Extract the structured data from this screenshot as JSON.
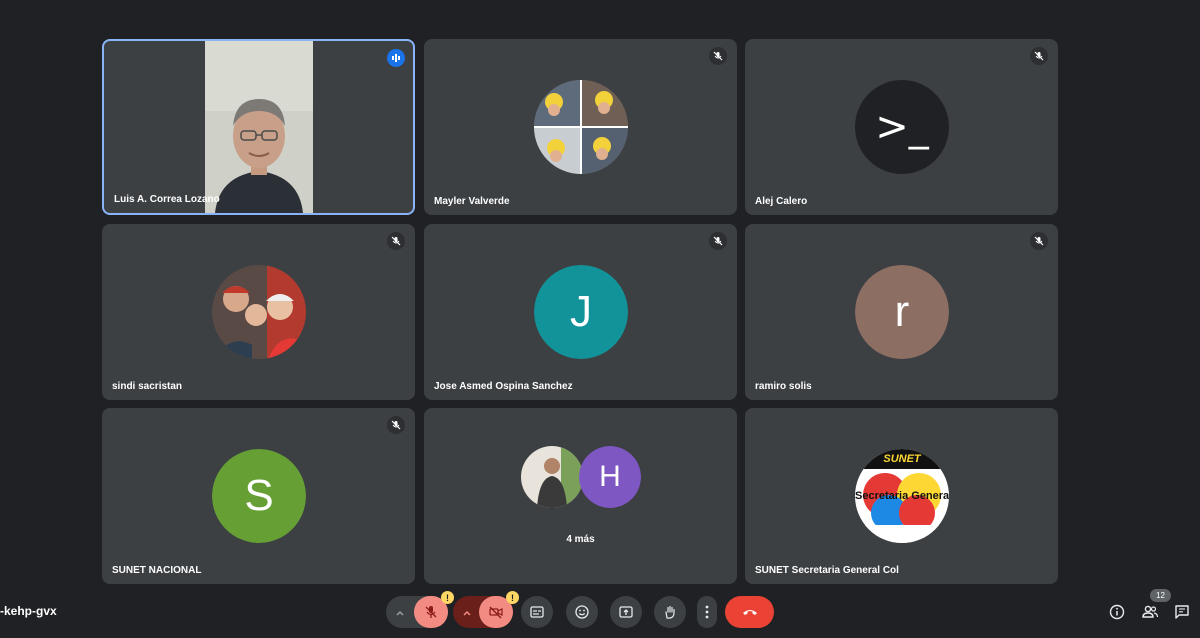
{
  "meeting": {
    "code": "-kehp-gvx",
    "participant_count": "12"
  },
  "tiles": [
    {
      "name": "Luis A. Correa Lozano",
      "state": "speaking"
    },
    {
      "name": "Mayler Valverde",
      "state": "muted"
    },
    {
      "name": "Alej Calero",
      "state": "muted",
      "avatar_text": ">_"
    },
    {
      "name": "sindi sacristan",
      "state": "muted"
    },
    {
      "name": "Jose Asmed Ospina Sanchez",
      "state": "muted",
      "initial": "J",
      "color": "#12939a"
    },
    {
      "name": "ramiro solis",
      "state": "muted",
      "initial": "r",
      "color": "#8d6e63"
    },
    {
      "name": "SUNET NACIONAL",
      "state": "muted",
      "initial": "S",
      "color": "#66a035"
    },
    {
      "more_label": "4 más",
      "initial": "H",
      "color": "#7e57c2"
    },
    {
      "name": "SUNET Secretaria General Col",
      "logo_text": "SUNET",
      "logo_subtext": "Secretaria General"
    }
  ],
  "controls": {
    "mic_warning": "!",
    "cam_warning": "!",
    "icons": [
      "chevron-up-icon",
      "mic-off-icon",
      "chevron-up-icon",
      "camera-off-icon",
      "captions-icon",
      "emoji-icon",
      "present-icon",
      "raise-hand-icon",
      "more-icon",
      "end-call-icon"
    ]
  },
  "right_icons": [
    "info-icon",
    "people-icon",
    "chat-icon"
  ],
  "colors": {
    "background": "#202124",
    "tile": "#3c4043",
    "active_border": "#8ab4f8",
    "end_call": "#ea4335",
    "muted_btn": "#f28b82"
  }
}
